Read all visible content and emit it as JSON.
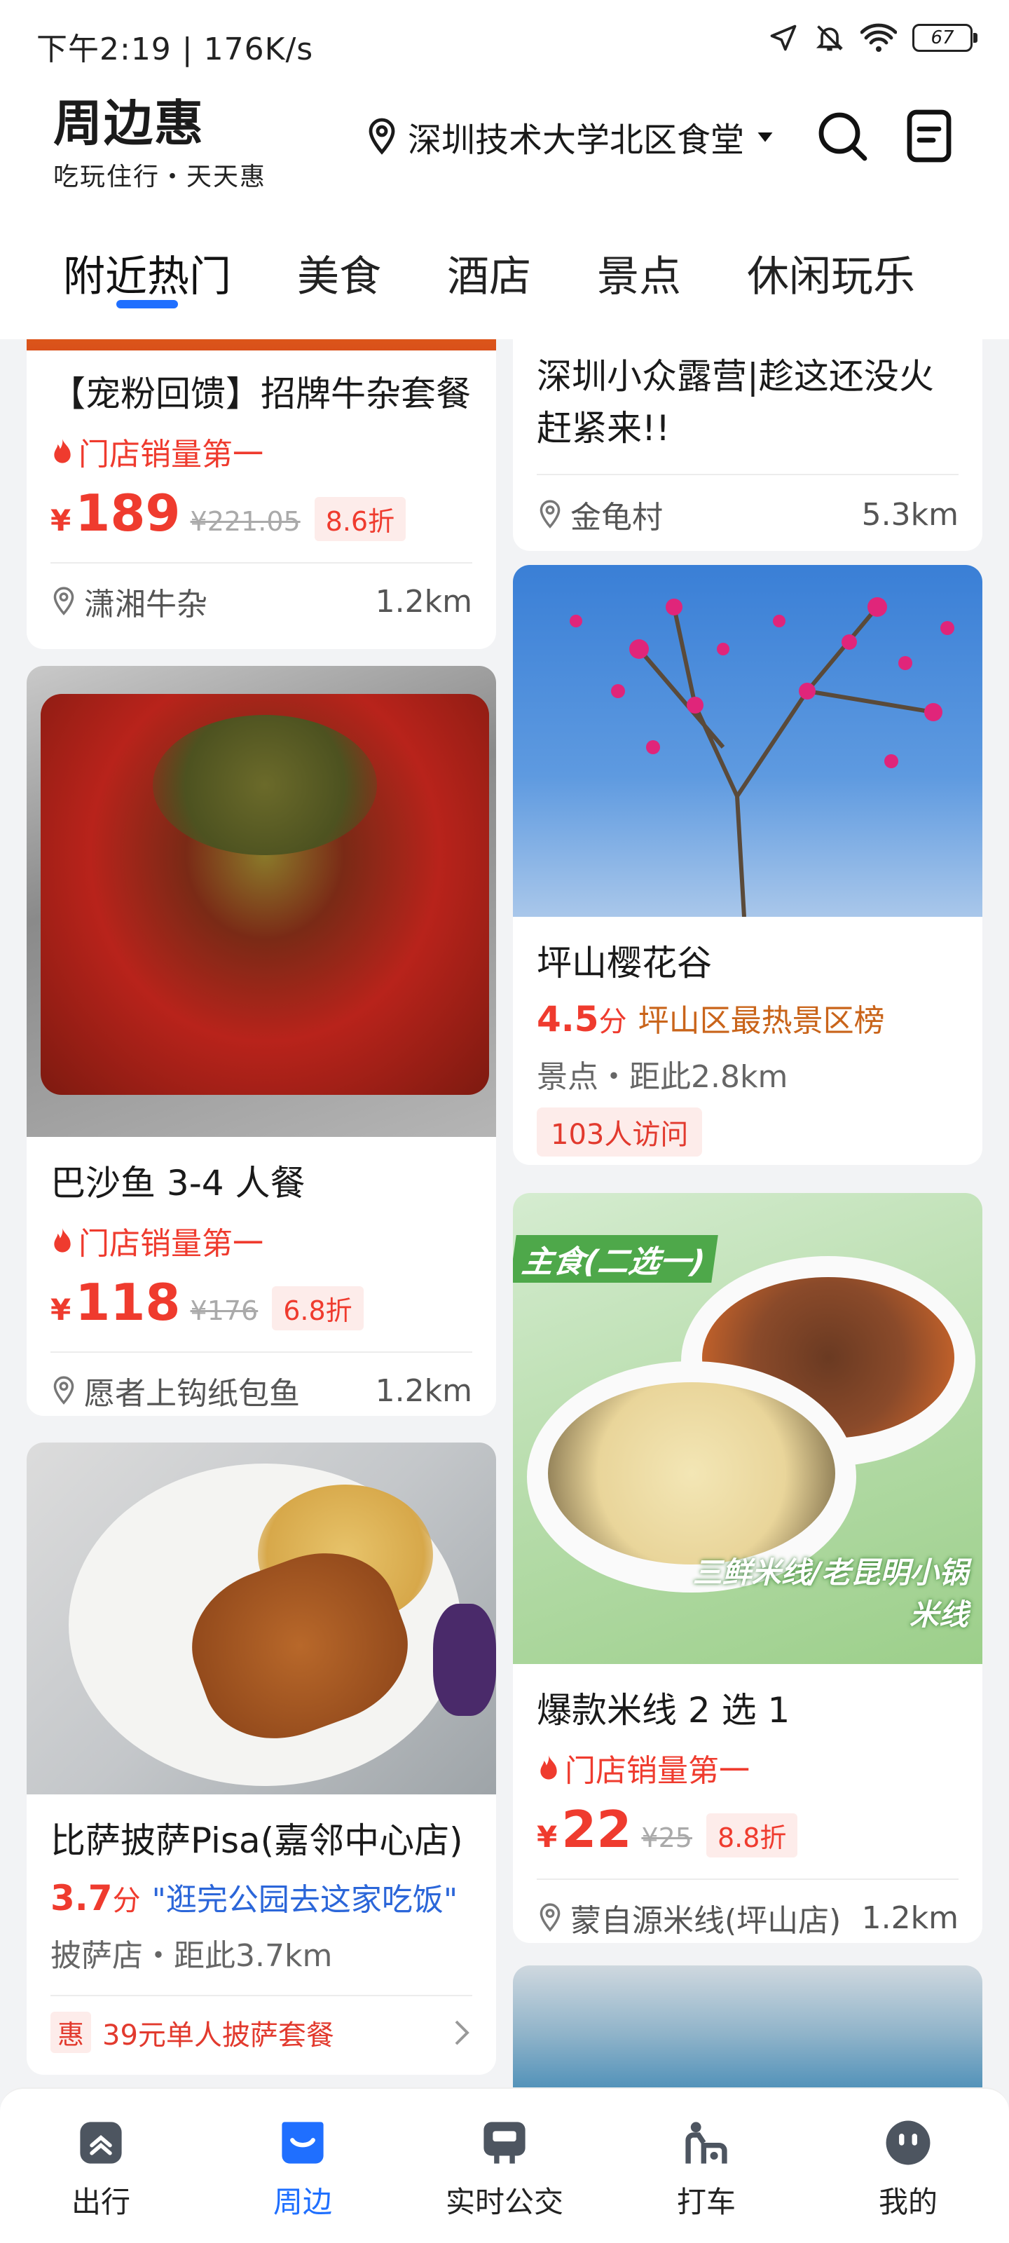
{
  "status": {
    "time": "下午2:19 | 176K/s",
    "battery": "67"
  },
  "header": {
    "brand": "周边惠",
    "slogan": "吃玩住行・天天惠",
    "location": "深圳技术大学北区食堂",
    "icons": [
      "location-pin-icon",
      "chevron-down-icon",
      "search-icon",
      "order-list-icon"
    ]
  },
  "tabs": [
    "附近热门",
    "美食",
    "酒店",
    "景点",
    "休闲玩乐"
  ],
  "feed": {
    "left": [
      {
        "title": "【宠粉回馈】招牌牛杂套餐",
        "tag": "门店销量第一",
        "price": "189",
        "old_price": "¥221.05",
        "discount": "8.6折",
        "shop": "潇湘牛杂",
        "distance": "1.2km"
      },
      {
        "title": "巴沙鱼 3-4 人餐",
        "tag": "门店销量第一",
        "price": "118",
        "old_price": "¥176",
        "discount": "6.8折",
        "shop": "愿者上钩纸包鱼",
        "distance": "1.2km",
        "image": "grilled-fish-with-chili-photo"
      },
      {
        "title": "比萨披萨Pisa(嘉邻中心店)",
        "score": "3.7",
        "score_unit": "分",
        "quote": "\"逛完公园去这家吃饭\"",
        "sub": "披萨店・距此3.7km",
        "deal_tag": "惠",
        "deal": "39元单人披萨套餐",
        "image": "steak-pasta-photo"
      }
    ],
    "right": [
      {
        "title": "深圳小众露营|趁这还没火赶紧来!!",
        "shop": "金龟村",
        "distance": "5.3km"
      },
      {
        "title": "坪山樱花谷",
        "score": "4.5",
        "score_unit": "分",
        "rank": "坪山区最热景区榜",
        "sub": "景点・距此2.8km",
        "visits": "103人访问",
        "image": "cherry-blossom-photo"
      },
      {
        "title": "爆款米线 2 选 1",
        "tag": "门店销量第一",
        "price": "22",
        "old_price": "¥25",
        "discount": "8.8折",
        "shop": "蒙自源米线(坪山店)",
        "distance": "1.2km",
        "image": "rice-noodle-bowls-photo",
        "banner_top": "主食(二选一)",
        "banner_bottom": "三鲜米线/老昆明小锅米线"
      }
    ],
    "yen": "¥"
  },
  "bottom_nav": [
    {
      "label": "出行",
      "icon": "travel-icon"
    },
    {
      "label": "周边",
      "icon": "nearby-icon",
      "active": true
    },
    {
      "label": "实时公交",
      "icon": "bus-icon"
    },
    {
      "label": "打车",
      "icon": "taxi-icon"
    },
    {
      "label": "我的",
      "icon": "profile-icon"
    }
  ],
  "colors": {
    "accent": "#1f6fff",
    "price": "#ef3b2e"
  }
}
